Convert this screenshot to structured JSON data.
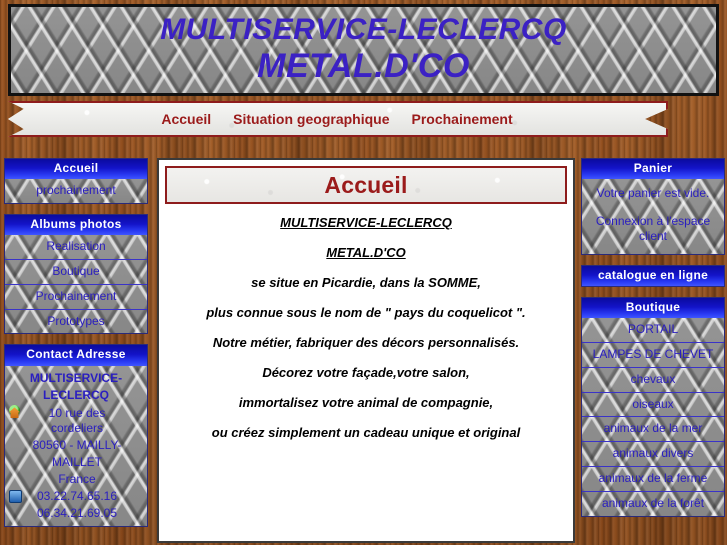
{
  "header": {
    "title_line1": "MULTISERVICE-LECLERCQ",
    "title_line2": "METAL.D'CO",
    "title_color": "#3B21C4"
  },
  "nav": {
    "items": [
      {
        "label": "Accueil"
      },
      {
        "label": "Situation geographique"
      },
      {
        "label": "Prochainement"
      }
    ],
    "link_color": "#9B1B1B"
  },
  "sidebar_left": {
    "panels": [
      {
        "heading": "Accueil",
        "items": [
          {
            "label": "prochainement"
          }
        ]
      },
      {
        "heading": "Albums photos",
        "items": [
          {
            "label": "Realisation"
          },
          {
            "label": "Boutique"
          },
          {
            "label": "Prochainement"
          },
          {
            "label": "Prototypes"
          }
        ]
      }
    ],
    "contact": {
      "heading": "Contact Adresse",
      "name_line1": "MULTISERVICE-",
      "name_line2": "LECLERCQ",
      "street": "10 rue des cordeliers",
      "city_line1": "80560 - MAILLY-",
      "city_line2": "MAILLET",
      "country": "France",
      "phone1": "03.22.74.65.16",
      "phone2": "06.34.21.69.05",
      "icons": {
        "person": "person-icon",
        "home": "home-icon",
        "phone": "phone-icon"
      }
    }
  },
  "sidebar_right": {
    "cart": {
      "heading": "Panier",
      "empty_text": "Votre panier est vide.",
      "login_link": "Connexion à l'espace client"
    },
    "catalogue": {
      "heading": "catalogue en ligne"
    },
    "boutique": {
      "heading": "Boutique",
      "items": [
        {
          "label": "PORTAIL"
        },
        {
          "label": "LAMPES DE CHEVET"
        },
        {
          "label": "chevaux"
        },
        {
          "label": "oiseaux"
        },
        {
          "label": "animaux de la mer"
        },
        {
          "label": "animaux divers"
        },
        {
          "label": "animaux de la ferme"
        },
        {
          "label": "animaux de la forêt"
        }
      ]
    }
  },
  "content": {
    "title": "Accueil",
    "paragraphs": [
      {
        "text": "MULTISERVICE-LECLERCQ",
        "underline": true
      },
      {
        "text": "METAL.D'CO",
        "underline": true
      },
      {
        "text": "se situe en Picardie, dans la SOMME,",
        "underline": false
      },
      {
        "text": "plus connue sous le nom de \" pays du coquelicot \".",
        "underline": false
      },
      {
        "text": "Notre métier, fabriquer des décors personnalisés.",
        "underline": false
      },
      {
        "text": "Décorez votre façade,votre salon,",
        "underline": false
      },
      {
        "text": "immortalisez votre animal de compagnie,",
        "underline": false
      },
      {
        "text": "ou créez simplement un cadeau unique et original",
        "underline": false
      }
    ],
    "title_color": "#9B1B1B"
  }
}
